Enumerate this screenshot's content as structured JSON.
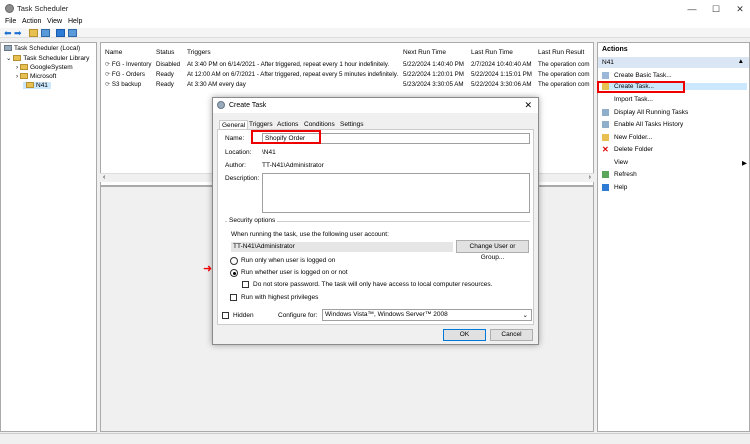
{
  "window": {
    "title": "Task Scheduler",
    "minimize": "—",
    "maximize": "☐",
    "close": "✕"
  },
  "menu": [
    "File",
    "Action",
    "View",
    "Help"
  ],
  "tree": {
    "root": "Task Scheduler (Local)",
    "library": "Task Scheduler Library",
    "children": [
      "GoogleSystem",
      "Microsoft",
      "N41"
    ]
  },
  "list": {
    "headers": [
      "Name",
      "Status",
      "Triggers",
      "Next Run Time",
      "Last Run Time",
      "Last Run Result"
    ],
    "rows": [
      [
        "FG - Inventory",
        "Disabled",
        "At 3:40 PM on 6/14/2021 - After triggered, repeat every 1 hour indefinitely.",
        "5/22/2024 1:40:40 PM",
        "2/7/2024 10:40:40 AM",
        "The operation com"
      ],
      [
        "FG - Orders",
        "Ready",
        "At 12:00 AM on 6/7/2021 - After triggered, repeat every 5 minutes indefinitely.",
        "5/22/2024 1:20:01 PM",
        "5/22/2024 1:15:01 PM",
        "The operation com"
      ],
      [
        "S3 backup",
        "Ready",
        "At 3:30 AM every day",
        "5/23/2024 3:30:05 AM",
        "5/22/2024 3:30:06 AM",
        "The operation com"
      ]
    ]
  },
  "actions": {
    "header": "Actions",
    "section": "N41",
    "items": [
      "Create Basic Task...",
      "Create Task...",
      "Import Task...",
      "Display All Running Tasks",
      "Enable All Tasks History",
      "New Folder...",
      "Delete Folder",
      "View",
      "Refresh",
      "Help"
    ]
  },
  "dialog": {
    "title": "Create Task",
    "tabs": [
      "General",
      "Triggers",
      "Actions",
      "Conditions",
      "Settings"
    ],
    "name_label": "Name:",
    "name_value": "Shopify Order",
    "location_label": "Location:",
    "location_value": "\\N41",
    "author_label": "Author:",
    "author_value": "TT-N41\\Administrator",
    "description_label": "Description:",
    "security_title": "Security options",
    "security_text": "When running the task, use the following user account:",
    "account": "TT-N41\\Administrator",
    "change_user_button": "Change User or Group...",
    "radio_logged_on": "Run only when user is logged on",
    "radio_whether": "Run whether user is logged on or not",
    "no_store_password": "Do not store password.  The task will only have access to local computer resources.",
    "highest_privileges": "Run with highest privileges",
    "hidden": "Hidden",
    "configure_label": "Configure for:",
    "configure_value": "Windows Vista™, Windows Server™ 2008",
    "ok": "OK",
    "cancel": "Cancel"
  },
  "colors": {
    "highlight": "#e00000",
    "selection": "#cce8ff",
    "accent": "#0078d7"
  }
}
